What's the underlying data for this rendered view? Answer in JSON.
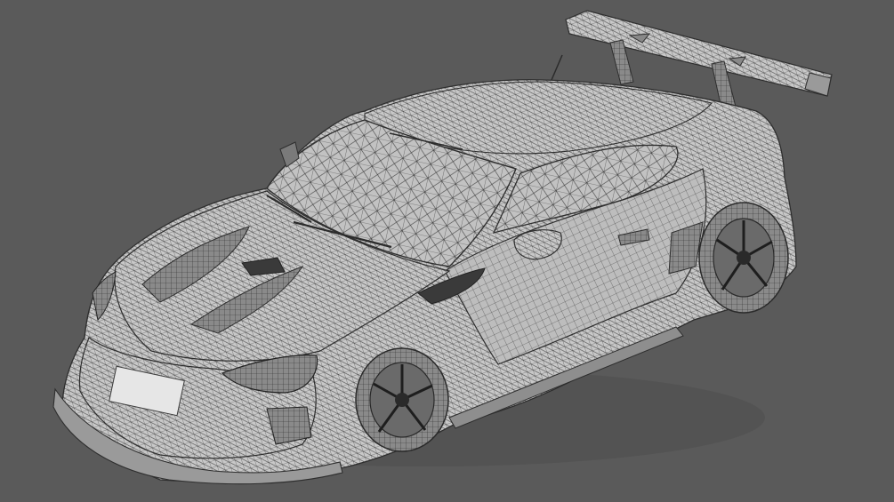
{
  "scene": {
    "background_color": "#5a5a5a",
    "subject": "car-wireframe",
    "mesh_fill_color": "#c8c8c8",
    "mesh_line_color": "#3a3a3a",
    "dark_detail_color": "#2b2b2b"
  }
}
